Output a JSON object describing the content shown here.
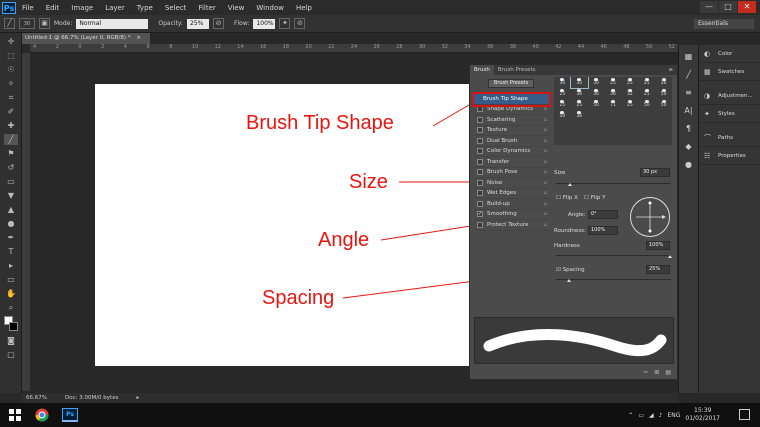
{
  "menubar": {
    "logo": "Ps",
    "items": [
      "File",
      "Edit",
      "Image",
      "Layer",
      "Type",
      "Select",
      "Filter",
      "View",
      "Window",
      "Help"
    ],
    "window_controls": [
      "—",
      "□",
      "✕"
    ]
  },
  "options_bar": {
    "brush_size": "30",
    "mode_label": "Mode:",
    "mode_value": "Normal",
    "opacity_label": "Opacity:",
    "opacity_value": "25%",
    "flow_label": "Flow:",
    "flow_value": "100%",
    "workspace": "Essentials"
  },
  "document": {
    "tab_title": "Untitled-1 @ 66.7% (Layer 0, RGB/8) *",
    "ruler_ticks": [
      "4",
      "2",
      "0",
      "2",
      "4",
      "6",
      "8",
      "10",
      "12",
      "14",
      "16",
      "18",
      "20",
      "22",
      "24",
      "26",
      "28",
      "30",
      "32",
      "34",
      "36",
      "38",
      "40",
      "42",
      "44",
      "46",
      "48",
      "50",
      "52"
    ],
    "zoom": "66.67%",
    "doc_info": "Doc: 3.00M/0 bytes"
  },
  "annotations": {
    "brush_tip_shape": "Brush Tip Shape",
    "size": "Size",
    "angle": "Angle",
    "spacing": "Spacing",
    "color": "#e8150f"
  },
  "brush_panel": {
    "tabs": [
      "Brush",
      "Brush Presets"
    ],
    "presets_button": "Brush Presets",
    "options": [
      {
        "label": "Brush Tip Shape",
        "checked": false,
        "selected": true
      },
      {
        "label": "Shape Dynamics",
        "checked": false
      },
      {
        "label": "Scattering",
        "checked": false
      },
      {
        "label": "Texture",
        "checked": false
      },
      {
        "label": "Dual Brush",
        "checked": false
      },
      {
        "label": "Color Dynamics",
        "checked": false
      },
      {
        "label": "Transfer",
        "checked": false
      },
      {
        "label": "Brush Pose",
        "checked": false
      },
      {
        "label": "Noise",
        "checked": false
      },
      {
        "label": "Wet Edges",
        "checked": false
      },
      {
        "label": "Build-up",
        "checked": false
      },
      {
        "label": "Smoothing",
        "checked": true
      },
      {
        "label": "Protect Texture",
        "checked": false
      }
    ],
    "tip_sizes": [
      "30",
      "30",
      "30",
      "25",
      "25",
      "25",
      "36",
      "25",
      "36",
      "36",
      "36",
      "32",
      "25",
      "50",
      "25",
      "25",
      "50",
      "71",
      "25",
      "50",
      "50",
      "50",
      "36"
    ],
    "size_label": "Size",
    "size_value": "30 px",
    "flip_x": "Flip X",
    "flip_y": "Flip Y",
    "angle_label": "Angle:",
    "angle_value": "0°",
    "roundness_label": "Roundness:",
    "roundness_value": "100%",
    "hardness_label": "Hardness",
    "hardness_value": "100%",
    "spacing_label": "Spacing",
    "spacing_value": "25%",
    "spacing_checked": true
  },
  "dock": {
    "items": [
      {
        "label": "Color",
        "icon": "color-icon"
      },
      {
        "label": "Swatches",
        "icon": "swatches-icon"
      },
      {
        "label": "Adjustmen...",
        "icon": "adjustments-icon"
      },
      {
        "label": "Styles",
        "icon": "styles-icon"
      },
      {
        "label": "Paths",
        "icon": "paths-icon"
      },
      {
        "label": "Properties",
        "icon": "properties-icon"
      }
    ]
  },
  "taskbar": {
    "language": "ENG",
    "time": "15:39",
    "date": "01/02/2017"
  }
}
